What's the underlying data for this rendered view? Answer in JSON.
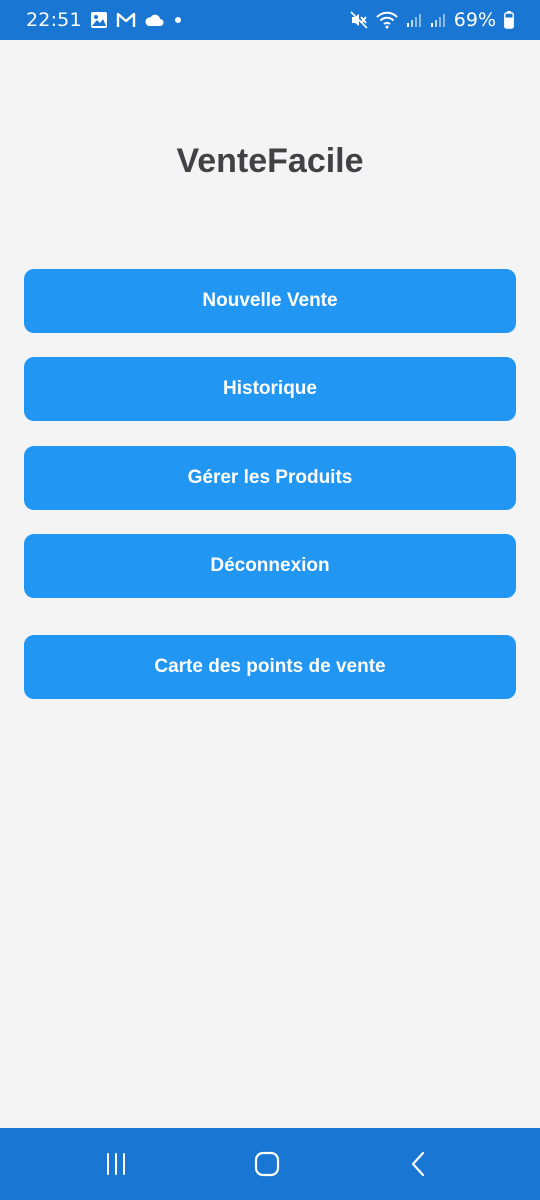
{
  "status_bar": {
    "time": "22:51",
    "battery": "69%",
    "icons_left": [
      "gallery-icon",
      "gmail-icon",
      "cloud-icon",
      "dot-icon"
    ],
    "icons_right": [
      "mute-icon",
      "wifi-icon",
      "signal-icon",
      "signal-icon",
      "battery-icon"
    ]
  },
  "app": {
    "title": "VenteFacile"
  },
  "menu": {
    "buttons": [
      {
        "label": "Nouvelle Vente"
      },
      {
        "label": "Historique"
      },
      {
        "label": "Gérer les Produits"
      },
      {
        "label": "Déconnexion"
      },
      {
        "label": "Carte des points de vente"
      }
    ]
  },
  "colors": {
    "status_bar": "#1976d2",
    "nav_bar": "#1976d2",
    "button": "#2196f3",
    "background": "#f4f4f4",
    "title": "#424246"
  },
  "nav_bar": {
    "icons": [
      "recents-icon",
      "home-icon",
      "back-icon"
    ]
  }
}
